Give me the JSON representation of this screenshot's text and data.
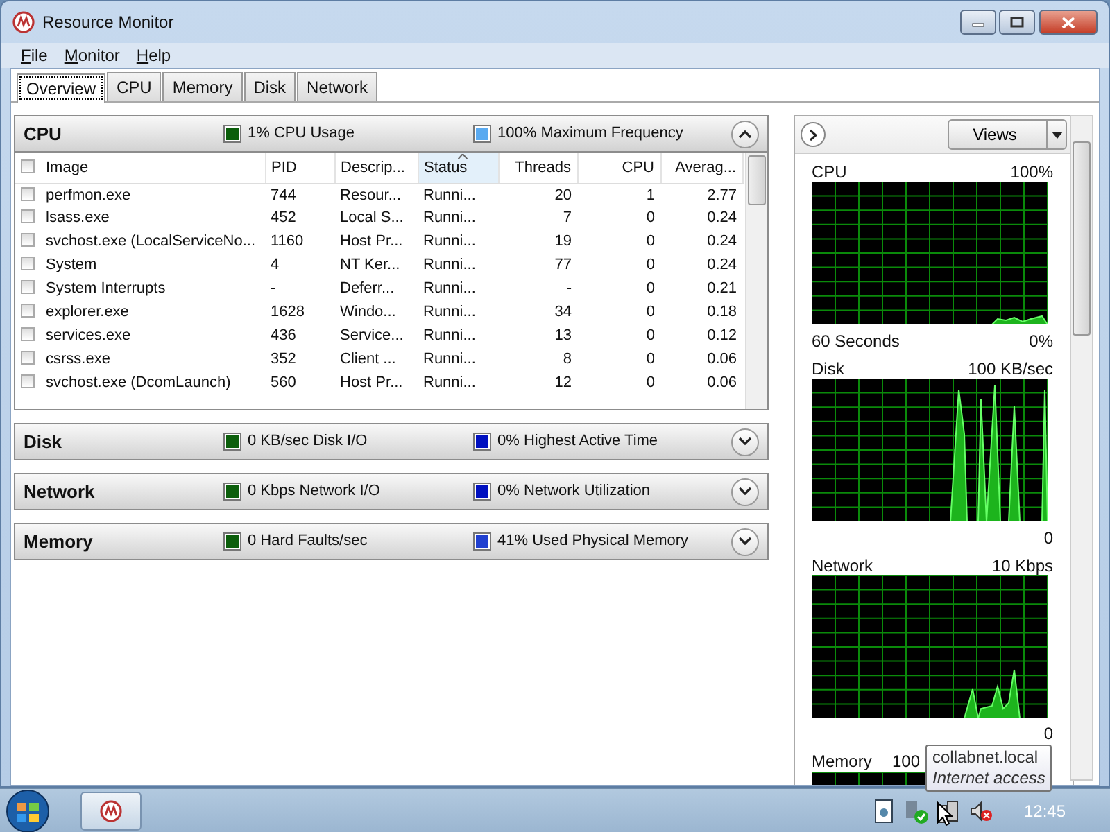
{
  "window": {
    "title": "Resource Monitor"
  },
  "menu": [
    {
      "label": "File"
    },
    {
      "label": "Monitor"
    },
    {
      "label": "Help"
    }
  ],
  "tabs": [
    {
      "label": "Overview",
      "selected": true
    },
    {
      "label": "CPU",
      "selected": false
    },
    {
      "label": "Memory",
      "selected": false
    },
    {
      "label": "Disk",
      "selected": false
    },
    {
      "label": "Network",
      "selected": false
    }
  ],
  "sections": [
    {
      "title": "CPU",
      "expanded": true,
      "metrics": [
        {
          "text": "1% CPU Usage",
          "color": "#0b5e0b"
        },
        {
          "text": "100% Maximum Frequency",
          "color": "#5aaaf0"
        }
      ]
    },
    {
      "title": "Disk",
      "expanded": false,
      "metrics": [
        {
          "text": "0 KB/sec Disk I/O",
          "color": "#0b5e0b"
        },
        {
          "text": "0% Highest Active Time",
          "color": "#0010c0"
        }
      ]
    },
    {
      "title": "Network",
      "expanded": false,
      "metrics": [
        {
          "text": "0 Kbps Network I/O",
          "color": "#0b5e0b"
        },
        {
          "text": "0% Network Utilization",
          "color": "#0010c0"
        }
      ]
    },
    {
      "title": "Memory",
      "expanded": false,
      "metrics": [
        {
          "text": "0 Hard Faults/sec",
          "color": "#0b5e0b"
        },
        {
          "text": "41% Used Physical Memory",
          "color": "#2040d0"
        }
      ]
    }
  ],
  "cpu_table": {
    "columns": [
      {
        "label": "Image",
        "sorted": false
      },
      {
        "label": "PID",
        "sorted": false
      },
      {
        "label": "Descrip...",
        "sorted": false
      },
      {
        "label": "Status",
        "sorted": true
      },
      {
        "label": "Threads",
        "sorted": false
      },
      {
        "label": "CPU",
        "sorted": false
      },
      {
        "label": "Averag...",
        "sorted": false
      }
    ],
    "rows": [
      {
        "checked": false,
        "cells": [
          "perfmon.exe",
          "744",
          "Resour...",
          "Runni...",
          "20",
          "1",
          "2.77"
        ]
      },
      {
        "checked": false,
        "cells": [
          "lsass.exe",
          "452",
          "Local S...",
          "Runni...",
          "7",
          "0",
          "0.24"
        ]
      },
      {
        "checked": false,
        "cells": [
          "svchost.exe (LocalServiceNo...",
          "1160",
          "Host Pr...",
          "Runni...",
          "19",
          "0",
          "0.24"
        ]
      },
      {
        "checked": false,
        "cells": [
          "System",
          "4",
          "NT Ker...",
          "Runni...",
          "77",
          "0",
          "0.24"
        ]
      },
      {
        "checked": false,
        "cells": [
          "System Interrupts",
          "-",
          "Deferr...",
          "Runni...",
          "-",
          "0",
          "0.21"
        ]
      },
      {
        "checked": false,
        "cells": [
          "explorer.exe",
          "1628",
          "Windo...",
          "Runni...",
          "34",
          "0",
          "0.18"
        ]
      },
      {
        "checked": false,
        "cells": [
          "services.exe",
          "436",
          "Service...",
          "Runni...",
          "13",
          "0",
          "0.12"
        ]
      },
      {
        "checked": false,
        "cells": [
          "csrss.exe",
          "352",
          "Client ...",
          "Runni...",
          "8",
          "0",
          "0.06"
        ]
      },
      {
        "checked": false,
        "cells": [
          "svchost.exe (DcomLaunch)",
          "560",
          "Host Pr...",
          "Runni...",
          "12",
          "0",
          "0.06"
        ]
      }
    ]
  },
  "side_panel": {
    "views_button": "Views",
    "graphs": [
      {
        "title": "CPU",
        "scale_max": "100%",
        "time_span": "60 Seconds",
        "scale_min": "0%"
      },
      {
        "title": "Disk",
        "scale_max": "100 KB/sec",
        "scale_min": "0"
      },
      {
        "title": "Network",
        "scale_max": "10 Kbps",
        "scale_min": "0"
      },
      {
        "title": "Memory",
        "scale_max": "100"
      }
    ]
  },
  "tooltip": {
    "title": "collabnet.local",
    "subtitle": "Internet access"
  },
  "taskbar": {
    "clock": "12:45"
  }
}
